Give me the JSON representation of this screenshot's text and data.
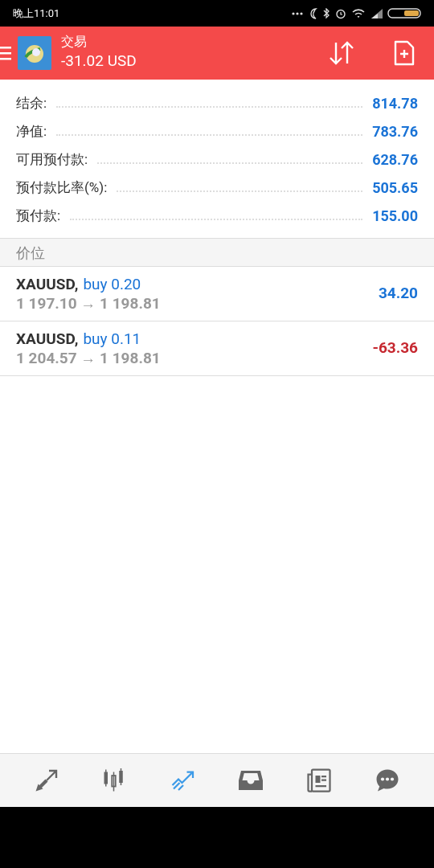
{
  "status_bar": {
    "time": "晚上11:01"
  },
  "header": {
    "title": "交易",
    "balance": "-31.02 USD"
  },
  "summary": [
    {
      "label": "结余:",
      "value": "814.78"
    },
    {
      "label": "净值:",
      "value": "783.76"
    },
    {
      "label": "可用预付款:",
      "value": "628.76"
    },
    {
      "label": "预付款比率(%):",
      "value": "505.65"
    },
    {
      "label": "预付款:",
      "value": "155.00"
    }
  ],
  "section": {
    "title": "价位"
  },
  "positions": [
    {
      "symbol": "XAUUSD,",
      "order": "buy 0.20",
      "prices": "1 197.10 → 1 198.81",
      "profit": "34.20",
      "color": "#1a73d6"
    },
    {
      "symbol": "XAUUSD,",
      "order": "buy 0.11",
      "prices": "1 204.57 → 1 198.81",
      "profit": "-63.36",
      "color": "#c62830"
    }
  ],
  "nav": [
    {
      "selected": false
    },
    {
      "selected": false
    },
    {
      "selected": true
    },
    {
      "selected": false
    },
    {
      "selected": false
    },
    {
      "selected": false
    }
  ]
}
